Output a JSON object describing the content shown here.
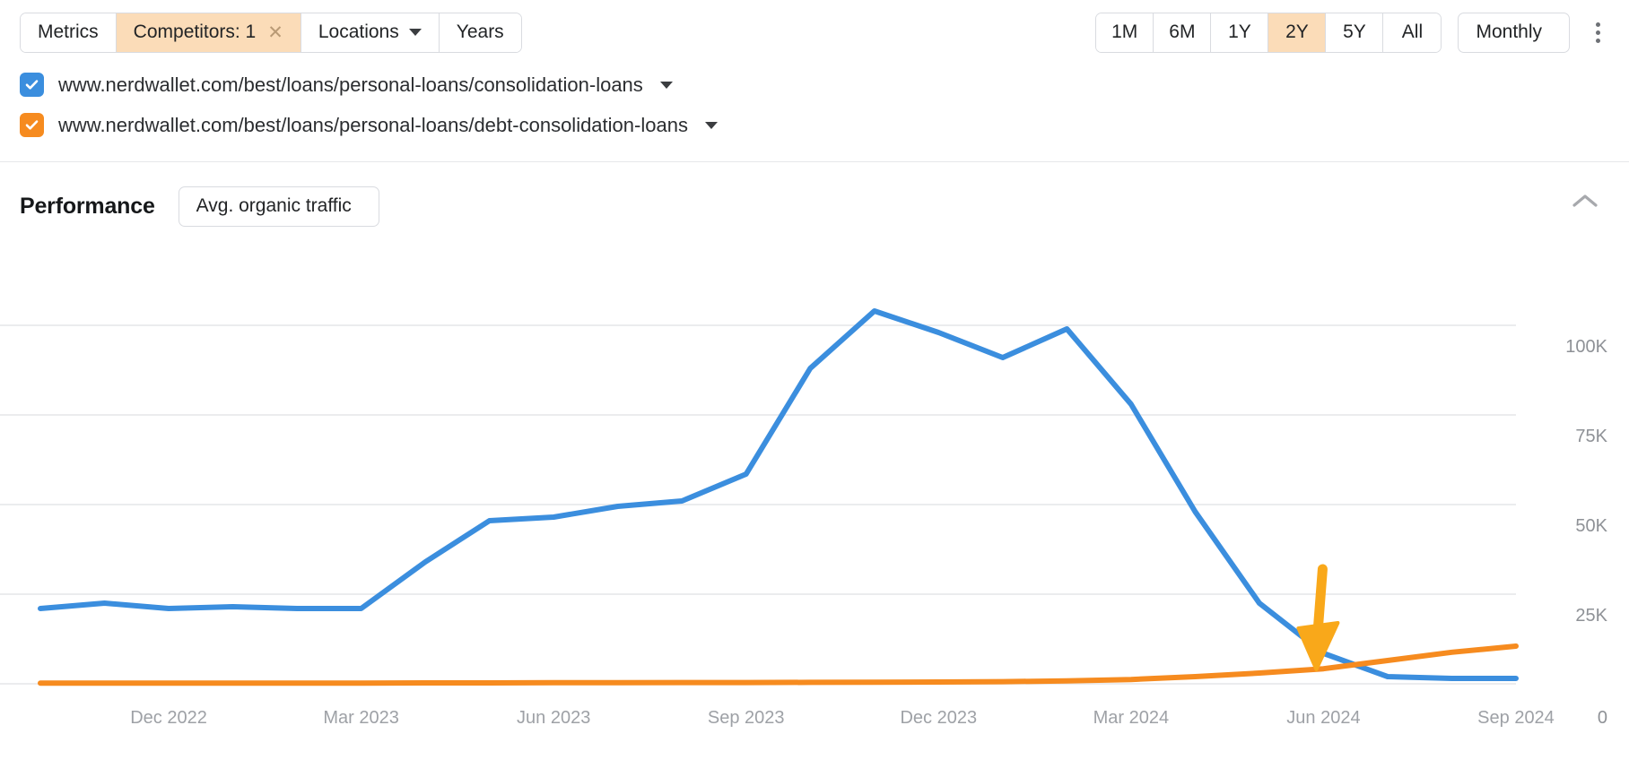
{
  "toolbar": {
    "filters": [
      {
        "label": "Metrics",
        "type": "plain",
        "active": false
      },
      {
        "label": "Competitors: 1",
        "type": "removable",
        "active": true,
        "close_label": "✕"
      },
      {
        "label": "Locations",
        "type": "dropdown",
        "active": false
      },
      {
        "label": "Years",
        "type": "plain",
        "active": false
      }
    ],
    "ranges": [
      {
        "label": "1M",
        "active": false
      },
      {
        "label": "6M",
        "active": false
      },
      {
        "label": "1Y",
        "active": false
      },
      {
        "label": "2Y",
        "active": true
      },
      {
        "label": "5Y",
        "active": false
      },
      {
        "label": "All",
        "active": false
      }
    ],
    "granularity": {
      "label": "Monthly"
    },
    "more_menu": "more-options"
  },
  "urls": [
    {
      "checked": true,
      "color": "#3b8ede",
      "text": "www.nerdwallet.com/best/loans/personal-loans/consolidation-loans"
    },
    {
      "checked": true,
      "color": "#f68b1f",
      "text": "www.nerdwallet.com/best/loans/personal-loans/debt-consolidation-loans"
    }
  ],
  "performance": {
    "title": "Performance",
    "metric_selector": "Avg. organic traffic",
    "collapsed": false
  },
  "colors": {
    "series_blue": "#3b8ede",
    "series_orange": "#f68b1f",
    "highlight_bg": "#fbdcb8",
    "border": "#d9dbe0",
    "gridline": "#ebecee",
    "annotation_arrow": "#f9a81a"
  },
  "chart_data": {
    "type": "line",
    "title": "Avg. organic traffic",
    "xlabel": "",
    "ylabel": "",
    "grid": true,
    "legend": "none",
    "ylim": [
      0,
      115000
    ],
    "yticks": [
      0,
      25000,
      50000,
      75000,
      100000
    ],
    "ytick_labels": [
      "0",
      "25K",
      "50K",
      "75K",
      "100K"
    ],
    "xtick_labels": [
      "Dec 2022",
      "Mar 2023",
      "Jun 2023",
      "Sep 2023",
      "Dec 2023",
      "Mar 2024",
      "Jun 2024",
      "Sep 2024"
    ],
    "x": [
      "Oct 2022",
      "Nov 2022",
      "Dec 2022",
      "Jan 2023",
      "Feb 2023",
      "Mar 2023",
      "Apr 2023",
      "May 2023",
      "Jun 2023",
      "Jul 2023",
      "Aug 2023",
      "Sep 2023",
      "Oct 2023",
      "Nov 2023",
      "Dec 2023",
      "Jan 2024",
      "Feb 2024",
      "Mar 2024",
      "Apr 2024",
      "May 2024",
      "Jun 2024",
      "Jul 2024",
      "Aug 2024",
      "Sep 2024"
    ],
    "series": [
      {
        "name": "www.nerdwallet.com/best/loans/personal-loans/consolidation-loans",
        "color": "#3b8ede",
        "values": [
          21000,
          22500,
          21000,
          21500,
          21000,
          21000,
          34000,
          45500,
          46500,
          49500,
          51000,
          58500,
          88000,
          104000,
          98000,
          91000,
          99000,
          78000,
          48000,
          22500,
          8500,
          2000,
          1500,
          1500
        ]
      },
      {
        "name": "www.nerdwallet.com/best/loans/personal-loans/debt-consolidation-loans",
        "color": "#f68b1f",
        "values": [
          200,
          200,
          200,
          200,
          200,
          200,
          250,
          250,
          300,
          300,
          350,
          350,
          400,
          450,
          500,
          600,
          800,
          1200,
          2000,
          3000,
          4200,
          6500,
          8800,
          10500
        ]
      }
    ],
    "annotations": [
      {
        "type": "arrow",
        "direction": "down",
        "color": "#f9a81a",
        "points_at": "crossover of blue and orange series near Jun 2024"
      }
    ]
  }
}
